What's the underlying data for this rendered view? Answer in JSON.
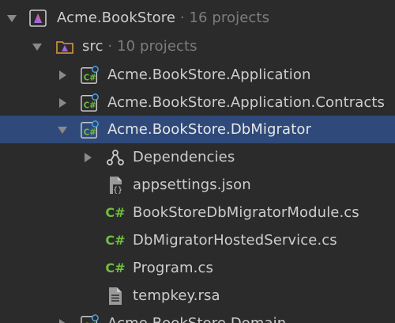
{
  "solution": {
    "name": "Acme.BookStore",
    "meta": "· 16 projects"
  },
  "src_folder": {
    "name": "src",
    "meta": "· 10 projects"
  },
  "projects": [
    {
      "name": "Acme.BookStore.Application"
    },
    {
      "name": "Acme.BookStore.Application.Contracts"
    },
    {
      "name": "Acme.BookStore.DbMigrator"
    }
  ],
  "dbmigrator_children": [
    {
      "name": "Dependencies",
      "icon": "dependencies-icon"
    },
    {
      "name": "appsettings.json",
      "icon": "json-file-icon"
    },
    {
      "name": "BookStoreDbMigratorModule.cs",
      "icon": "csharp-file-icon"
    },
    {
      "name": "DbMigratorHostedService.cs",
      "icon": "csharp-file-icon"
    },
    {
      "name": "Program.cs",
      "icon": "csharp-file-icon"
    },
    {
      "name": "tempkey.rsa",
      "icon": "text-file-icon"
    }
  ],
  "next_project": {
    "name": "Acme.BookStore.Domain"
  },
  "icon_text": {
    "csharp": "C#"
  },
  "colors": {
    "background": "#2b2b2b",
    "selection": "#2f4a7a",
    "csharp_green": "#6fbe3f",
    "project_purple": "#9b6ad6",
    "folder_orange": "#c88a3a"
  }
}
